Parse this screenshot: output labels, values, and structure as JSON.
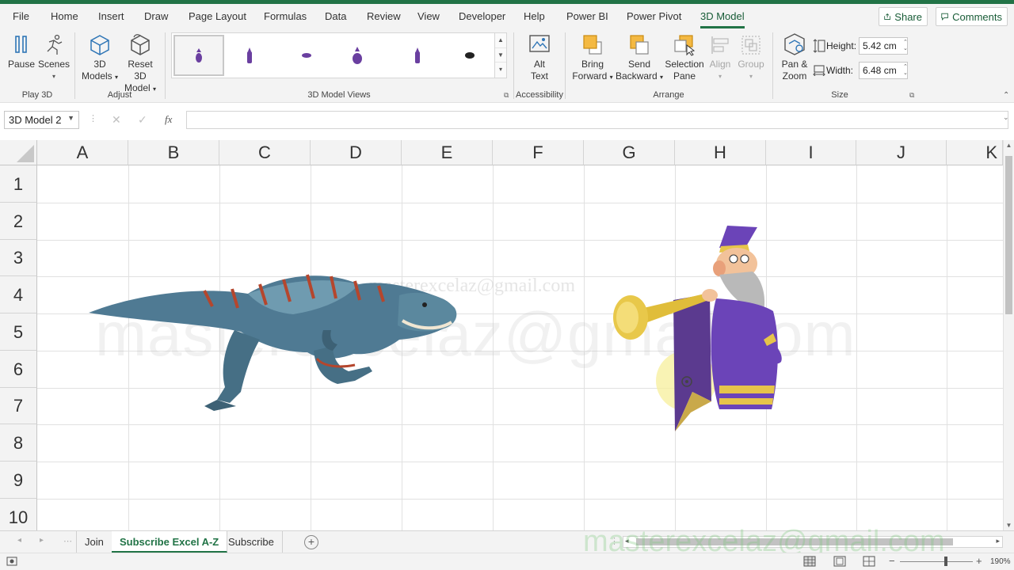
{
  "menu": {
    "tabs": [
      "File",
      "Home",
      "Insert",
      "Draw",
      "Page Layout",
      "Formulas",
      "Data",
      "Review",
      "View",
      "Developer",
      "Help",
      "Power BI",
      "Power Pivot",
      "3D Model"
    ],
    "active_tab": "3D Model",
    "share": "Share",
    "comments": "Comments"
  },
  "ribbon": {
    "play3d": {
      "pause": "Pause",
      "scenes": "Scenes",
      "label": "Play 3D"
    },
    "adjust": {
      "models_line1": "3D",
      "models_line2": "Models",
      "reset_line1": "Reset 3D",
      "reset_line2": "Model",
      "label": "Adjust"
    },
    "views": {
      "label": "3D Model Views"
    },
    "accessibility": {
      "alt_line1": "Alt",
      "alt_line2": "Text",
      "label": "Accessibility"
    },
    "arrange": {
      "bring_line1": "Bring",
      "bring_line2": "Forward",
      "send_line1": "Send",
      "send_line2": "Backward",
      "selection_line1": "Selection",
      "selection_line2": "Pane",
      "align": "Align",
      "group": "Group",
      "label": "Arrange"
    },
    "size": {
      "pan_line1": "Pan &",
      "pan_line2": "Zoom",
      "height_label": "Height:",
      "height_value": "5.42 cm",
      "width_label": "Width:",
      "width_value": "6.48 cm",
      "label": "Size"
    }
  },
  "formula_bar": {
    "name_box": "3D Model 2",
    "fx": "fx",
    "cancel": "✕",
    "enter": "✓"
  },
  "grid": {
    "columns": [
      "A",
      "B",
      "C",
      "D",
      "E",
      "F",
      "G",
      "H",
      "I",
      "J",
      "K"
    ],
    "rows": [
      "1",
      "2",
      "3",
      "4",
      "5",
      "6",
      "7",
      "8",
      "9",
      "10"
    ]
  },
  "watermarks": {
    "big": "masterexcelaz@gmail.com",
    "small": "masterexcelaz@gmail.com",
    "green": "masterexcelaz@gmail.com"
  },
  "sheets": {
    "tabs": [
      "Join",
      "Subscribe Excel A-Z",
      "Subscribe"
    ],
    "active": "Subscribe Excel A-Z"
  },
  "status": {
    "zoom": "190%"
  },
  "colors": {
    "excel_green": "#217346",
    "accent_dark": "#185c37",
    "ribbon_bg": "#f3f3f3"
  }
}
